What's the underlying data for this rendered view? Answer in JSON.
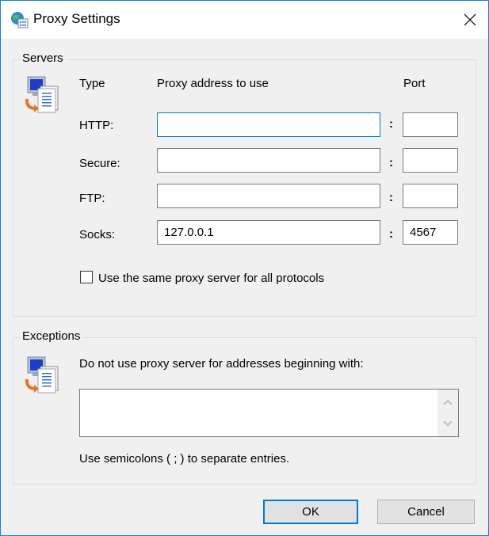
{
  "window": {
    "title": "Proxy Settings",
    "icon": "globe-settings-icon",
    "close_icon": "close-icon"
  },
  "servers": {
    "group_label": "Servers",
    "icon": "proxy-server-icon",
    "headers": {
      "type": "Type",
      "address": "Proxy address to use",
      "port": "Port"
    },
    "separator": ":",
    "rows": [
      {
        "label": "HTTP:",
        "address": "",
        "port": ""
      },
      {
        "label": "Secure:",
        "address": "",
        "port": ""
      },
      {
        "label": "FTP:",
        "address": "",
        "port": ""
      },
      {
        "label": "Socks:",
        "address": "127.0.0.1",
        "port": "4567"
      }
    ],
    "same_proxy_checkbox": {
      "label": "Use the same proxy server for all protocols",
      "checked": false
    }
  },
  "exceptions": {
    "group_label": "Exceptions",
    "icon": "proxy-server-icon",
    "instruction": "Do not use proxy server for addresses beginning with:",
    "value": "",
    "hint": "Use semicolons ( ; ) to separate entries."
  },
  "buttons": {
    "ok": "OK",
    "cancel": "Cancel"
  },
  "colors": {
    "accent": "#0078d7",
    "window_border": "#1a7fd8",
    "background": "#f0f0f0"
  }
}
